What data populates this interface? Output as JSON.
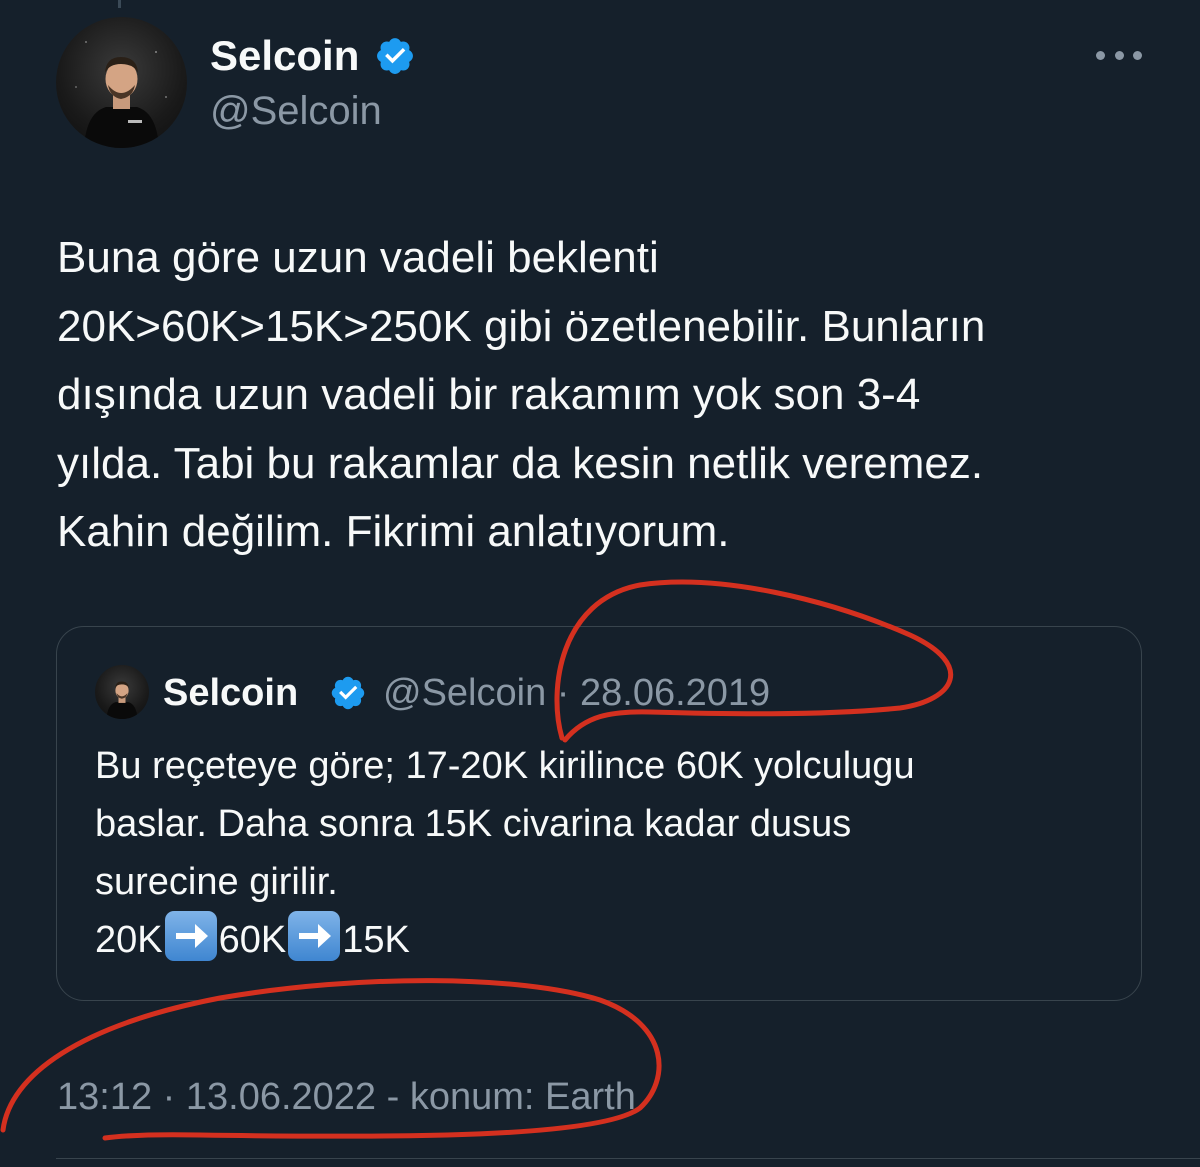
{
  "tweet": {
    "author": {
      "name": "Selcoin",
      "handle": "@Selcoin",
      "verified": true,
      "avatar_icon": "profile-photo"
    },
    "more_icon": "more-horizontal-icon",
    "text_lines": [
      "Buna göre uzun vadeli beklenti",
      "20K>60K>15K>250K gibi özetlenebilir. Bunların",
      "dışında uzun vadeli bir rakamım yok son 3-4",
      "yılda. Tabi bu rakamlar da kesin netlik veremez.",
      "Kahin değilim. Fikrimi anlatıyorum."
    ],
    "quoted": {
      "name": "Selcoin",
      "handle": "@Selcoin",
      "separator": "·",
      "date": "28.06.2019",
      "text_lines": [
        "Bu reçeteye göre; 17-20K kirilince 60K yolculugu",
        "baslar. Daha sonra 15K civarina kadar dusus",
        "surecine girilir."
      ],
      "sequence": [
        "20K",
        "60K",
        "15K"
      ],
      "arrow_icon": "right-arrow-emoji"
    },
    "footer": {
      "time": "13:12",
      "separator": "·",
      "date": "13.06.2022",
      "location": "- konum: Earth"
    }
  },
  "colors": {
    "background": "#15202b",
    "text": "#f7f9f9",
    "secondary": "#8b98a5",
    "border": "#38444d",
    "verified": "#1d9bf0",
    "annotation": "#d4301f"
  }
}
